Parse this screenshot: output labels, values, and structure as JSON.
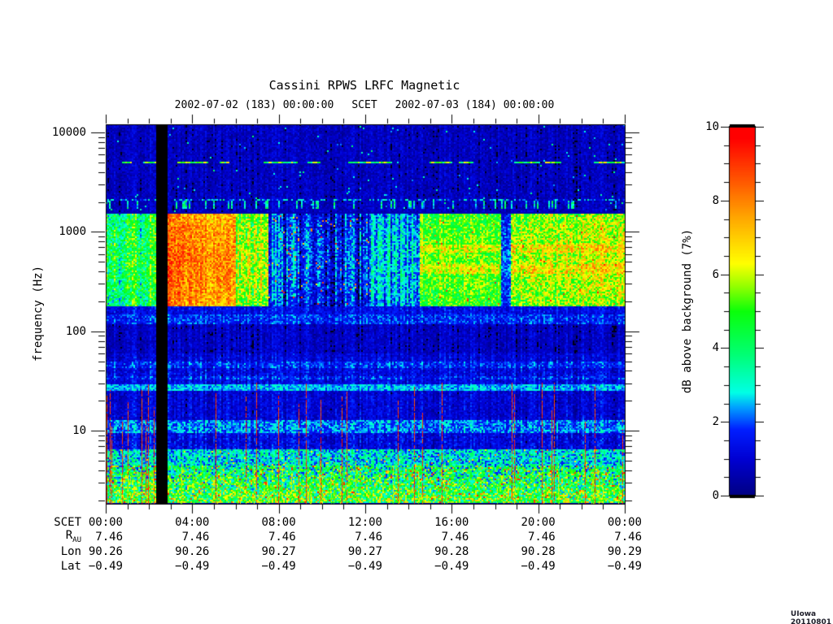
{
  "title": "Cassini RPWS LRFC Magnetic",
  "subtitle": {
    "start": "2002-07-02 (183) 00:00:00",
    "scet": "SCET",
    "end": "2002-07-03 (184) 00:00:00"
  },
  "stamp": "UIowa 20110801",
  "y_axis": {
    "label": "frequency (Hz)",
    "tick_values": [
      10000,
      1000,
      100,
      10
    ],
    "tick_labels": [
      "10000",
      "1000",
      "100",
      "10"
    ]
  },
  "x_axis": {
    "tick_hours": [
      0,
      4,
      8,
      12,
      16,
      20,
      24
    ],
    "tick_labels": [
      "00:00",
      "04:00",
      "08:00",
      "12:00",
      "16:00",
      "20:00",
      "00:00"
    ]
  },
  "ephemeris": {
    "rows": [
      {
        "label": "SCET",
        "sub": "",
        "values": [
          "00:00",
          "04:00",
          "08:00",
          "12:00",
          "16:00",
          "20:00",
          "00:00"
        ]
      },
      {
        "label": "R",
        "sub": "AU",
        "values": [
          "7.46",
          "7.46",
          "7.46",
          "7.46",
          "7.46",
          "7.46",
          "7.46"
        ]
      },
      {
        "label": "Lon",
        "sub": "",
        "values": [
          "90.26",
          "90.26",
          "90.27",
          "90.27",
          "90.28",
          "90.28",
          "90.29"
        ]
      },
      {
        "label": "Lat",
        "sub": "",
        "values": [
          "−0.49",
          "−0.49",
          "−0.49",
          "−0.49",
          "−0.49",
          "−0.49",
          "−0.49"
        ]
      }
    ]
  },
  "colorbar": {
    "label": "dB above background (7%)",
    "min": 0,
    "max": 10,
    "tick_values": [
      0,
      2,
      4,
      6,
      8,
      10
    ],
    "tick_labels": [
      "0",
      "2",
      "4",
      "6",
      "8",
      "10"
    ]
  },
  "chart_data": {
    "type": "heatmap",
    "title": "Cassini RPWS LRFC Magnetic",
    "subtitle": "2002-07-02 (183) 00:00:00  SCET  2002-07-03 (184) 00:00:00",
    "xlabel": "SCET (hours)",
    "ylabel": "frequency (Hz)",
    "y_scale": "log",
    "ylim_hz": [
      1.84,
      12100
    ],
    "xlim_hours": [
      0,
      24
    ],
    "value_label": "dB above background (7%)",
    "value_range": [
      0,
      10
    ],
    "legend_position": "right-colorbar",
    "grid": false,
    "seed": 20020702,
    "data_gap_hours": [
      2.3,
      2.86
    ],
    "colormap_stops": [
      [
        0,
        0,
        0,
        130
      ],
      [
        1,
        0,
        0,
        210
      ],
      [
        1.8,
        0,
        30,
        255
      ],
      [
        2.4,
        0,
        160,
        255
      ],
      [
        2.8,
        0,
        255,
        230
      ],
      [
        3.8,
        0,
        255,
        120
      ],
      [
        5,
        10,
        255,
        10
      ],
      [
        5.7,
        150,
        255,
        0
      ],
      [
        6.3,
        255,
        255,
        0
      ],
      [
        7.5,
        255,
        170,
        0
      ],
      [
        8.5,
        255,
        90,
        0
      ],
      [
        9.7,
        255,
        0,
        0
      ],
      [
        10,
        255,
        0,
        0
      ]
    ],
    "freq_bands": [
      {
        "f": [
          1600,
          12100
        ],
        "base": 0.75,
        "noise": 0.55,
        "col": 0.35,
        "outlier": [
          0.006,
          2.2,
          4.0
        ]
      },
      {
        "f": [
          150,
          178
        ],
        "base": 1.3,
        "noise": 0.6,
        "col": 0.4
      },
      {
        "f": [
          120,
          150
        ],
        "base": 1.7,
        "noise": 0.8,
        "col": 0.4
      },
      {
        "f": [
          60,
          120
        ],
        "base": 0.8,
        "noise": 0.55,
        "col": 0.5
      },
      {
        "f": [
          50,
          60
        ],
        "base": 1.1,
        "noise": 0.6,
        "col": 0.5
      },
      {
        "f": [
          42,
          50
        ],
        "base": 1.7,
        "noise": 0.8,
        "col": 0.5
      },
      {
        "f": [
          36,
          42
        ],
        "base": 1.2,
        "noise": 0.7,
        "col": 0.5
      },
      {
        "f": [
          33,
          36
        ],
        "base": 1.6,
        "noise": 0.8,
        "col": 0.5
      },
      {
        "f": [
          29,
          33
        ],
        "base": 1.2,
        "noise": 0.6,
        "col": 0.5
      },
      {
        "f": [
          25,
          29
        ],
        "base": 2.5,
        "noise": 0.7,
        "col": 0.4
      },
      {
        "f": [
          13,
          25
        ],
        "base": 1.05,
        "noise": 0.6,
        "col": 0.5
      },
      {
        "f": [
          9.5,
          13
        ],
        "base": 2.2,
        "noise": 0.9,
        "col": 0.5
      },
      {
        "f": [
          6.5,
          9.5
        ],
        "base": 1.2,
        "noise": 0.7,
        "col": 0.5
      },
      {
        "f": [
          4.5,
          6.5
        ],
        "base": 2.9,
        "noise": 1.3,
        "col": 0.4,
        "outlier": [
          0.02,
          6.0,
          8.5
        ]
      },
      {
        "f": [
          1.84,
          4.5
        ],
        "base": 3.6,
        "noise": 2.2,
        "col": 0.3,
        "grad": 1.4,
        "outlier": [
          0.06,
          6.5,
          9.5
        ]
      }
    ],
    "main_band": {
      "f": [
        178,
        1550
      ],
      "segments": [
        {
          "h": [
            0,
            2.3
          ],
          "base": 4.0,
          "noise": 1.5,
          "col": 1.1
        },
        {
          "h": [
            2.3,
            2.86
          ],
          "base": 0,
          "noise": 0,
          "col": 0,
          "gap": true
        },
        {
          "h": [
            2.86,
            6.0
          ],
          "base": 7.3,
          "noise": 1.2,
          "col": 0.4,
          "hot": 0.8
        },
        {
          "h": [
            6.0,
            7.5
          ],
          "base": 5.3,
          "noise": 1.5,
          "col": 0.9
        },
        {
          "h": [
            7.5,
            12.3
          ],
          "base": 1.2,
          "noise": 1.0,
          "col": 1.3,
          "outlier": [
            0.02,
            6.5,
            9.3
          ]
        },
        {
          "h": [
            12.3,
            14.5
          ],
          "base": 2.2,
          "noise": 1.1,
          "col": 1.0
        },
        {
          "h": [
            14.5,
            18.3
          ],
          "base": 4.9,
          "noise": 1.2,
          "col": 0.5,
          "hrows": 0.9,
          "outlier": [
            0.008,
            8.0,
            9.5
          ]
        },
        {
          "h": [
            18.3,
            18.7
          ],
          "base": 1.6,
          "noise": 0.9,
          "col": 0.4
        },
        {
          "h": [
            18.7,
            24
          ],
          "base": 5.3,
          "noise": 1.4,
          "col": 0.5,
          "hrows": 0.7,
          "ramp": 0.5,
          "outlier": [
            0.008,
            8.0,
            9.5
          ]
        }
      ]
    },
    "features": {
      "dotted_line_hz": 5000,
      "dotted_cluster_hours": [
        0.7,
        1.6,
        3.3,
        4.1,
        5.3,
        7.4,
        8.3,
        9.3,
        11.3,
        11.9,
        12.6,
        15.0,
        15.6,
        16.3,
        18.9,
        19.6,
        20.3,
        22.5,
        23.2
      ],
      "speckle_line_hz": 2100,
      "dash_band_hz": [
        1700,
        2050
      ],
      "red_spike_count": 30,
      "green_spike_count": 45
    }
  }
}
